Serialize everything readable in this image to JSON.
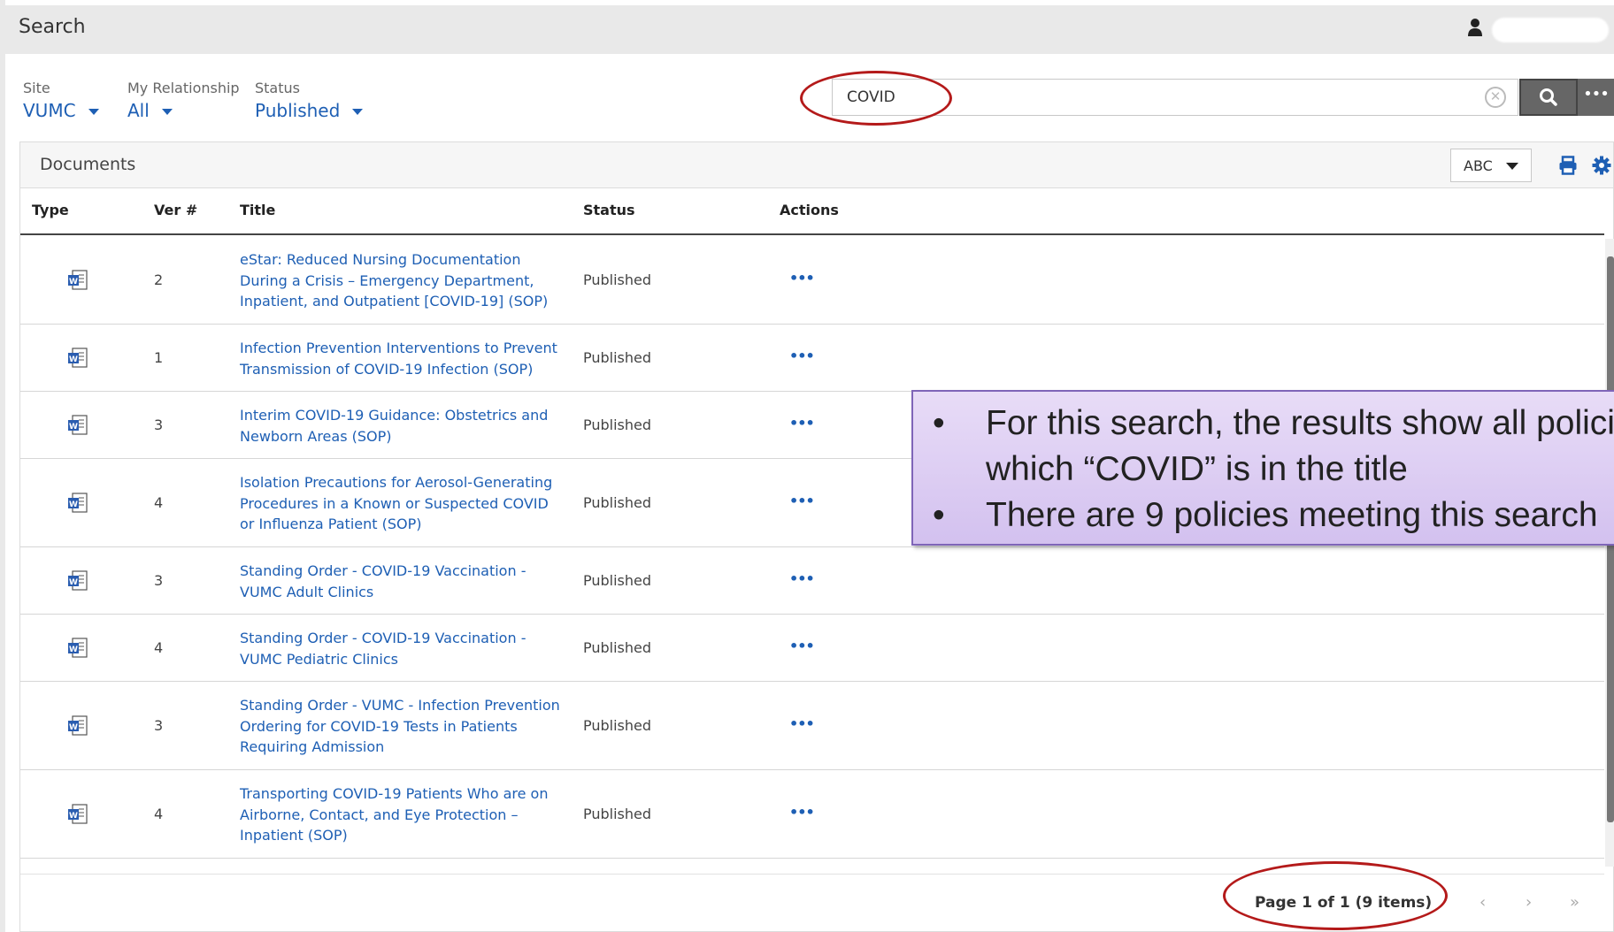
{
  "header": {
    "title": "Search"
  },
  "filters": [
    {
      "label": "Site",
      "value": "VUMC"
    },
    {
      "label": "My Relationship",
      "value": "All"
    },
    {
      "label": "Status",
      "value": "Published"
    }
  ],
  "search": {
    "value": "COVID"
  },
  "documents": {
    "title": "Documents",
    "sort_select": "ABC",
    "columns": [
      "Type",
      "Ver #",
      "Title",
      "Status",
      "Actions"
    ],
    "rows": [
      {
        "type_icon": "word-doc-icon",
        "ver": "2",
        "title": "eStar: Reduced Nursing Documentation During a Crisis – Emergency Department, Inpatient, and Outpatient [COVID-19] (SOP)",
        "status": "Published",
        "actions": "•••"
      },
      {
        "type_icon": "word-doc-icon",
        "ver": "1",
        "title": "Infection Prevention Interventions to Prevent Transmission of COVID-19 Infection (SOP)",
        "status": "Published",
        "actions": "•••"
      },
      {
        "type_icon": "word-doc-icon",
        "ver": "3",
        "title": "Interim COVID-19 Guidance: Obstetrics and Newborn Areas (SOP)",
        "status": "Published",
        "actions": "•••"
      },
      {
        "type_icon": "word-doc-icon",
        "ver": "4",
        "title": "Isolation Precautions for Aerosol-Generating Procedures in a Known or Suspected COVID or Influenza Patient (SOP)",
        "status": "Published",
        "actions": "•••"
      },
      {
        "type_icon": "word-doc-icon",
        "ver": "3",
        "title": "Standing Order - COVID-19 Vaccination - VUMC Adult Clinics",
        "status": "Published",
        "actions": "•••"
      },
      {
        "type_icon": "word-doc-icon",
        "ver": "4",
        "title": "Standing Order - COVID-19 Vaccination - VUMC Pediatric Clinics",
        "status": "Published",
        "actions": "•••"
      },
      {
        "type_icon": "word-doc-icon",
        "ver": "3",
        "title": "Standing Order - VUMC - Infection Prevention Ordering for COVID-19 Tests in Patients Requiring Admission",
        "status": "Published",
        "actions": "•••"
      },
      {
        "type_icon": "word-doc-icon",
        "ver": "4",
        "title": "Transporting COVID-19 Patients Who are on Airborne, Contact, and Eye Protection – Inpatient (SOP)",
        "status": "Published",
        "actions": "•••"
      }
    ]
  },
  "pager": {
    "text": "Page 1 of 1 (9 items)",
    "prev": "‹",
    "next": "›",
    "last": "»"
  },
  "callout": {
    "bullets": [
      "For this search, the results show all policies in which “COVID” is in the title",
      "There are 9 policies meeting this search"
    ]
  },
  "colors": {
    "link": "#1e5fb4",
    "highlight_ring": "#b41a1a",
    "callout_fill": "#d9c8f2"
  }
}
